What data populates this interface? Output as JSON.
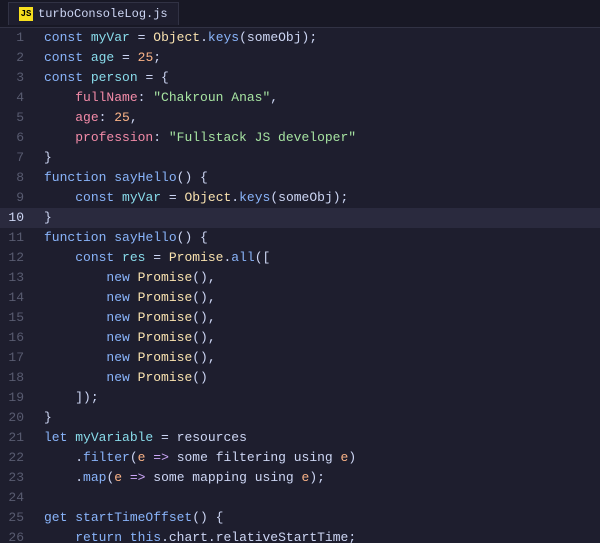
{
  "tab": {
    "icon_label": "JS",
    "filename": "turboConsoleLog.js"
  },
  "lines": [
    {
      "num": 1,
      "active": false
    },
    {
      "num": 2,
      "active": false
    },
    {
      "num": 3,
      "active": false
    },
    {
      "num": 4,
      "active": false
    },
    {
      "num": 5,
      "active": false
    },
    {
      "num": 6,
      "active": false
    },
    {
      "num": 7,
      "active": false
    },
    {
      "num": 8,
      "active": false
    },
    {
      "num": 9,
      "active": false
    },
    {
      "num": 10,
      "active": true
    },
    {
      "num": 11,
      "active": false
    },
    {
      "num": 12,
      "active": false
    },
    {
      "num": 13,
      "active": false
    },
    {
      "num": 14,
      "active": false
    },
    {
      "num": 15,
      "active": false
    },
    {
      "num": 16,
      "active": false
    },
    {
      "num": 17,
      "active": false
    },
    {
      "num": 18,
      "active": false
    },
    {
      "num": 19,
      "active": false
    },
    {
      "num": 20,
      "active": false
    },
    {
      "num": 21,
      "active": false
    },
    {
      "num": 22,
      "active": false
    },
    {
      "num": 23,
      "active": false
    },
    {
      "num": 24,
      "active": false
    },
    {
      "num": 25,
      "active": false
    },
    {
      "num": 26,
      "active": false
    }
  ]
}
